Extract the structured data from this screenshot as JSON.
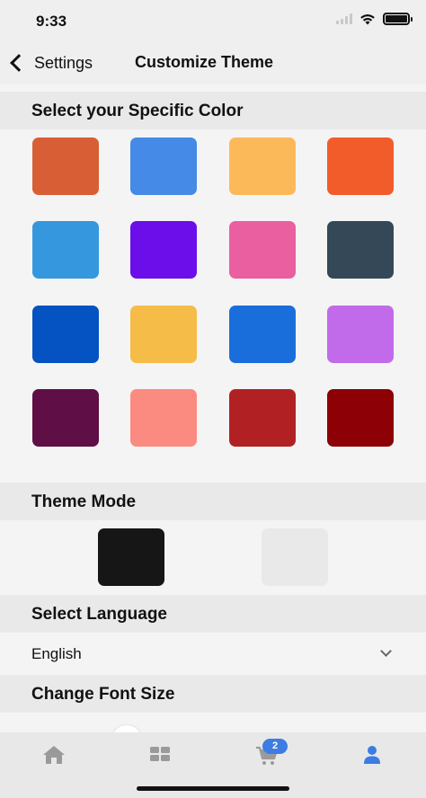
{
  "status": {
    "time": "9:33"
  },
  "nav": {
    "back_label": "Settings",
    "title": "Customize Theme"
  },
  "color_section": {
    "title": "Select your Specific Color",
    "swatches": [
      "#d85f35",
      "#448ae6",
      "#fcb95a",
      "#f25c2b",
      "#3598de",
      "#6b0ee9",
      "#e95f9f",
      "#344857",
      "#0552c2",
      "#f6bc48",
      "#1a6edb",
      "#c16bea",
      "#5f0f46",
      "#fb8b80",
      "#b12124",
      "#8c0006"
    ]
  },
  "theme_section": {
    "title": "Theme Mode",
    "modes": [
      {
        "name": "dark",
        "color": "#161616"
      },
      {
        "name": "light",
        "color": "#e9e9e9"
      }
    ]
  },
  "language_section": {
    "title": "Select Language",
    "value": "English"
  },
  "font_section": {
    "title": "Change Font Size"
  },
  "tab_bar": {
    "active_color": "#3d7ce3",
    "inactive_color": "#9a9a9a",
    "tabs": [
      {
        "icon": "home-icon"
      },
      {
        "icon": "grid-icon"
      },
      {
        "icon": "cart-icon",
        "badge": "2"
      },
      {
        "icon": "user-icon"
      }
    ]
  }
}
